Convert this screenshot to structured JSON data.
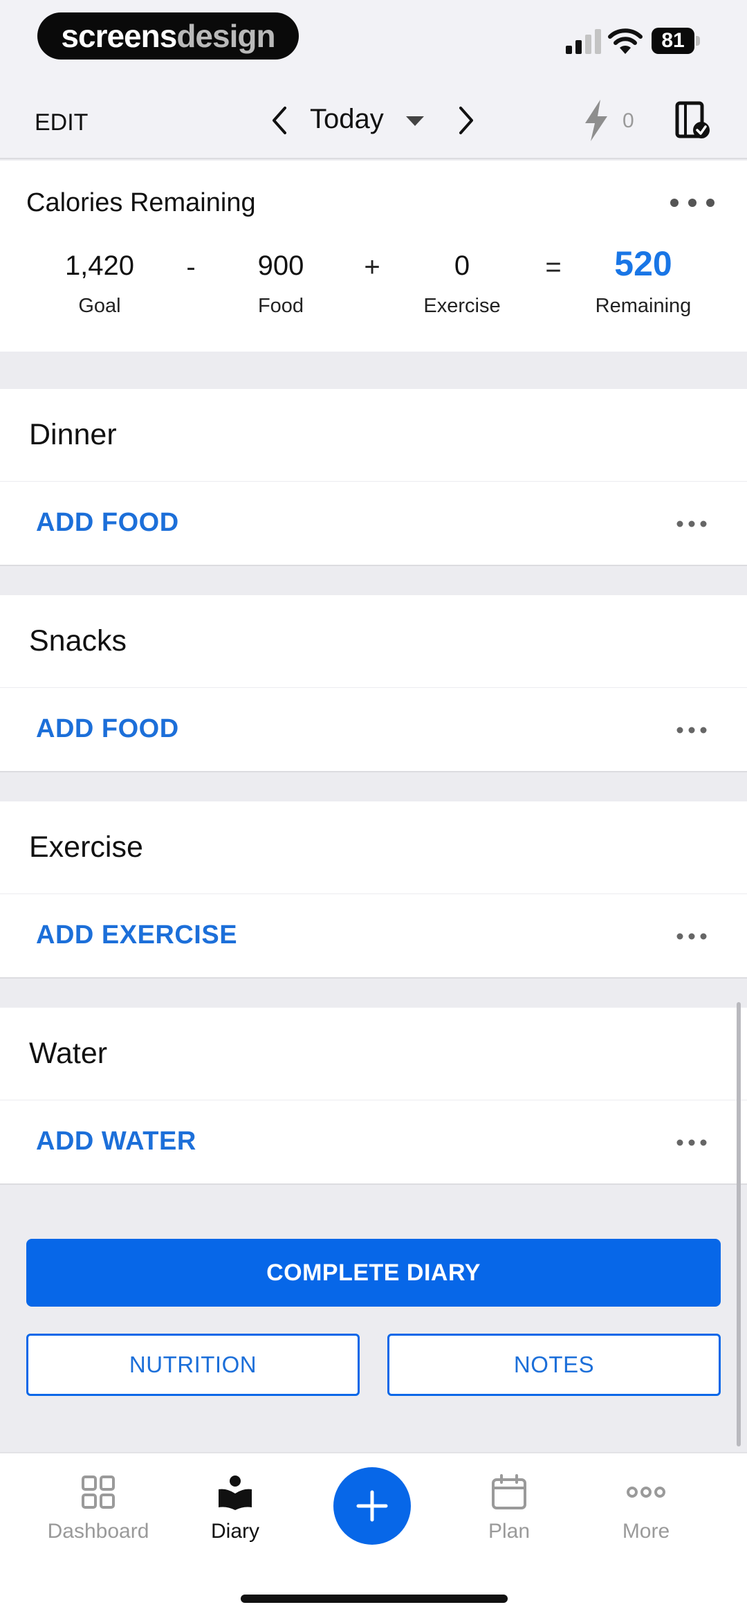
{
  "status_bar": {
    "brand_left": "screens",
    "brand_right": "design",
    "battery_level": "81"
  },
  "header": {
    "edit_label": "EDIT",
    "date_label": "Today",
    "streak_count": "0"
  },
  "calories": {
    "title": "Calories Remaining",
    "goal_value": "1,420",
    "goal_label": "Goal",
    "minus": "-",
    "food_value": "900",
    "food_label": "Food",
    "plus": "+",
    "exercise_value": "0",
    "exercise_label": "Exercise",
    "equals": "=",
    "remaining_value": "520",
    "remaining_label": "Remaining"
  },
  "sections": {
    "dinner": {
      "title": "Dinner",
      "action": "ADD FOOD"
    },
    "snacks": {
      "title": "Snacks",
      "action": "ADD FOOD"
    },
    "exercise": {
      "title": "Exercise",
      "action": "ADD EXERCISE"
    },
    "water": {
      "title": "Water",
      "action": "ADD WATER"
    }
  },
  "buttons": {
    "complete_diary": "COMPLETE DIARY",
    "nutrition": "NUTRITION",
    "notes": "NOTES"
  },
  "tabs": {
    "dashboard": "Dashboard",
    "diary": "Diary",
    "plan": "Plan",
    "more": "More"
  },
  "colors": {
    "accent": "#0767e8",
    "link": "#1c6fd9",
    "remaining": "#1976e6"
  }
}
